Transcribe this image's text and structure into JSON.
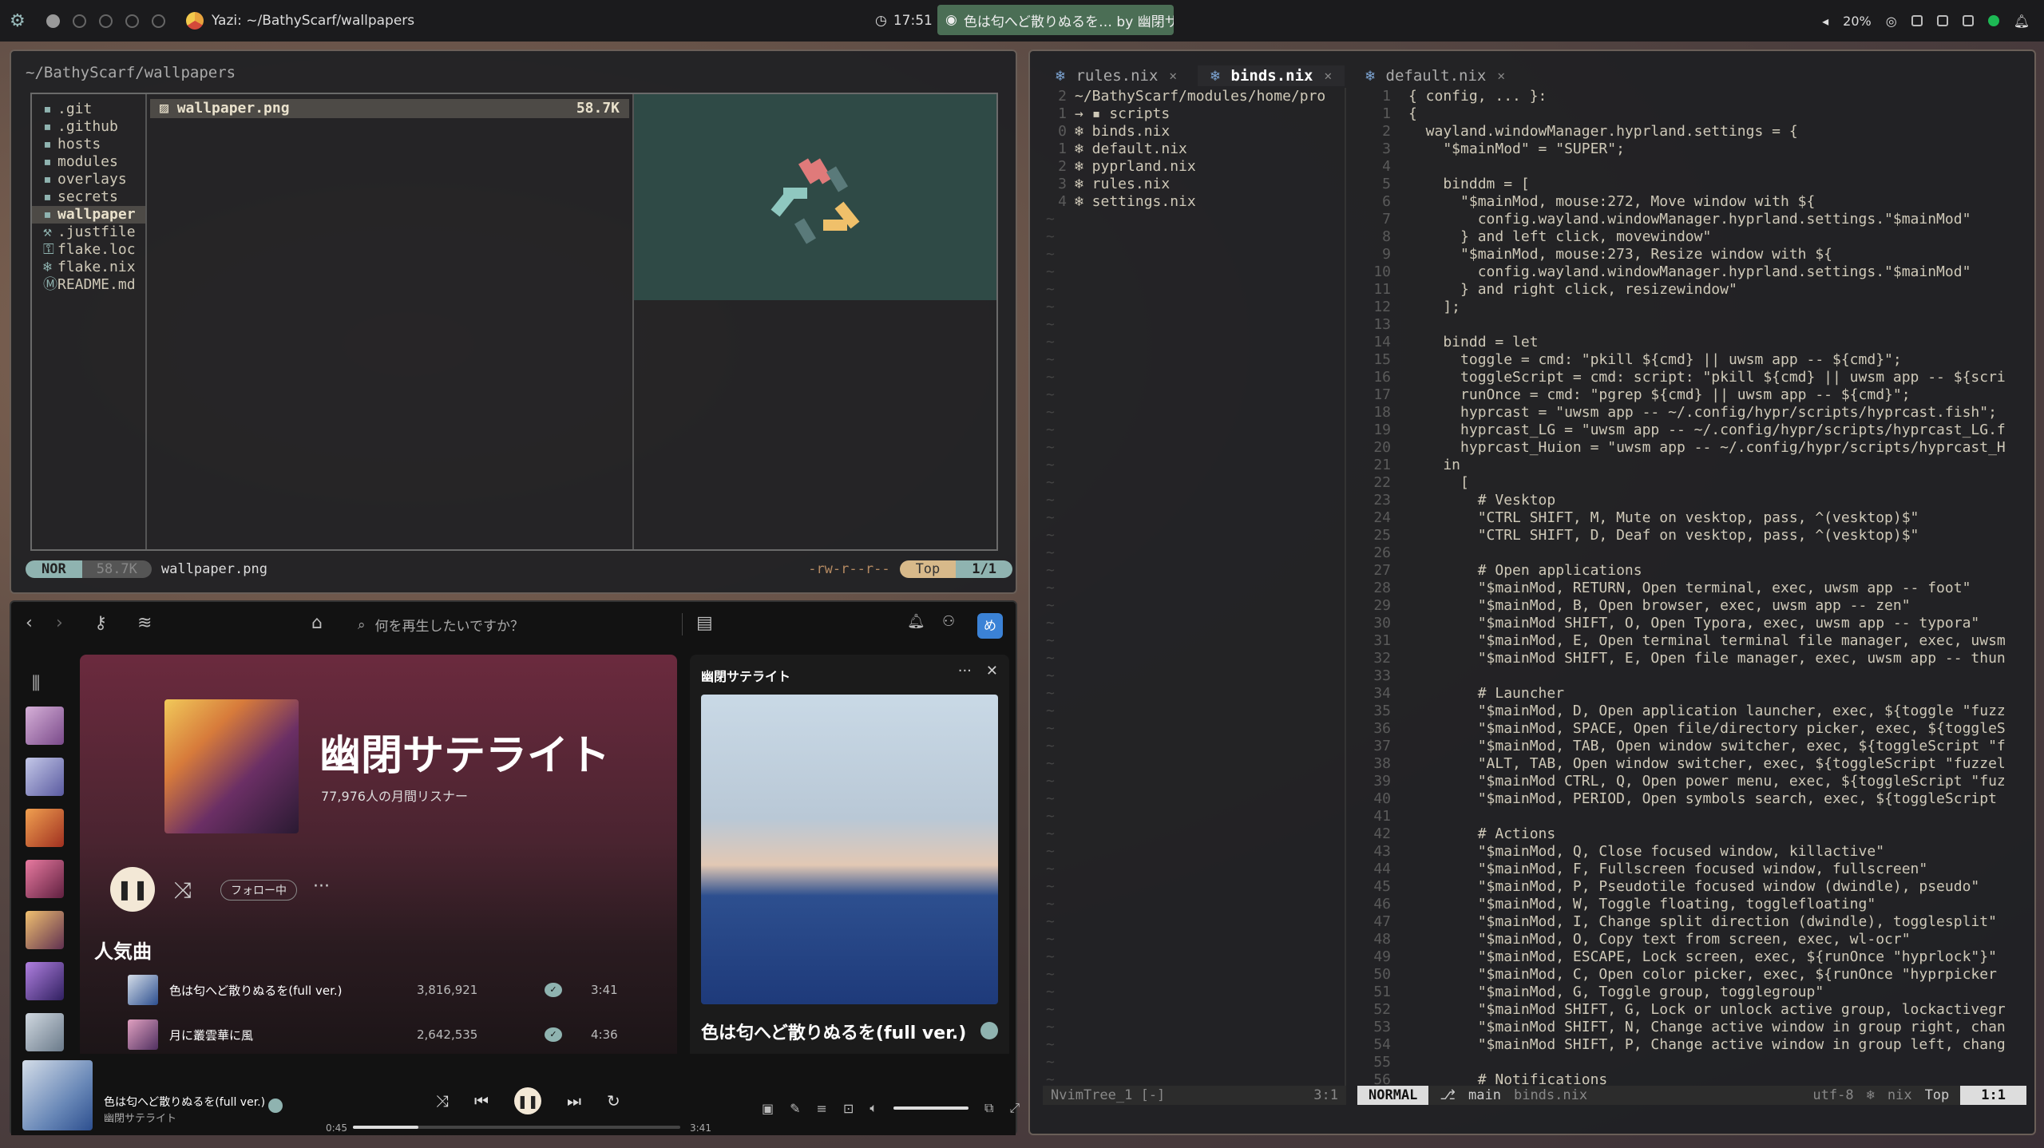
{
  "topbar": {
    "window_title": "Yazi: ~/BathyScarf/wallpapers",
    "clock": "17:51",
    "media": "色は匂へど散りぬるを… by 幽閉サテ…",
    "battery": "20%"
  },
  "yazi": {
    "path": "~/BathyScarf/wallpapers",
    "parent_items": [
      {
        "icon": "folder-icon",
        "glyph": "▪",
        "name": ".git"
      },
      {
        "icon": "folder-icon",
        "glyph": "▪",
        "name": ".github"
      },
      {
        "icon": "folder-icon",
        "glyph": "▪",
        "name": "hosts"
      },
      {
        "icon": "folder-icon",
        "glyph": "▪",
        "name": "modules"
      },
      {
        "icon": "folder-icon",
        "glyph": "▪",
        "name": "overlays"
      },
      {
        "icon": "folder-icon",
        "glyph": "▪",
        "name": "secrets"
      },
      {
        "icon": "folder-icon",
        "glyph": "▪",
        "name": "wallpaper",
        "selected": true
      },
      {
        "icon": "wrench-icon",
        "glyph": "⚒",
        "name": ".justfile"
      },
      {
        "icon": "lock-icon",
        "glyph": "⚿",
        "name": "flake.loc"
      },
      {
        "icon": "nix-icon",
        "glyph": "❄",
        "name": "flake.nix"
      },
      {
        "icon": "markdown-icon",
        "glyph": "Ⓜ",
        "name": "README.md"
      }
    ],
    "files": [
      {
        "name": "wallpaper.png",
        "size": "58.7K"
      }
    ],
    "status": {
      "mode": "NOR",
      "size": "58.7K",
      "filename": "wallpaper.png",
      "permissions": "-rw-r--r--",
      "scroll": "Top",
      "position": "1/1"
    }
  },
  "spotify": {
    "search_placeholder": "何を再生したいですか？",
    "avatar_letter": "め",
    "artist": {
      "name": "幽閉サテライト",
      "listeners": "77,976人の月間リスナー",
      "follow": "フォロー中"
    },
    "popular_heading": "人気曲",
    "tracks": [
      {
        "title": "色は匂へど散りぬるを(full ver.)",
        "plays": "3,816,921",
        "duration": "3:41"
      },
      {
        "title": "月に叢雲華に風",
        "plays": "2,642,535",
        "duration": "4:36"
      }
    ],
    "now_playing_panel": {
      "title": "幽閉サテライト",
      "song": "色は匂へど散りぬるを(full ver.)"
    },
    "player": {
      "song": "色は匂へど散りぬるを(full ver.)",
      "artist": "幽閉サテライト",
      "elapsed": "0:45",
      "total": "3:41",
      "progress": 0.2
    },
    "colors": {
      "accent": "#8fb3b0",
      "banner": "#6b2a3e"
    }
  },
  "nvim": {
    "tabs": [
      {
        "label": "rules.nix",
        "selected": false
      },
      {
        "label": "binds.nix",
        "selected": true
      },
      {
        "label": "default.nix",
        "selected": false
      }
    ],
    "tree_rows": [
      {
        "n": "2",
        "text": "~/BathyScarf/modules/home/pro"
      },
      {
        "n": "1",
        "text": " → ▪ scripts"
      },
      {
        "n": "0",
        "text": "  ❄ binds.nix"
      },
      {
        "n": "1",
        "text": "  ❄ default.nix"
      },
      {
        "n": "2",
        "text": "  ❄ pyprland.nix"
      },
      {
        "n": "3",
        "text": "  ❄ rules.nix"
      },
      {
        "n": "4",
        "text": "  ❄ settings.nix"
      }
    ],
    "code_lines": [
      {
        "n": "1",
        "text": "{ config, ... }:"
      },
      {
        "n": "1",
        "text": "{"
      },
      {
        "n": "2",
        "text": "  wayland.windowManager.hyprland.settings = {"
      },
      {
        "n": "3",
        "text": "    \"$mainMod\" = \"SUPER\";"
      },
      {
        "n": "4",
        "text": ""
      },
      {
        "n": "5",
        "text": "    binddm = ["
      },
      {
        "n": "6",
        "text": "      \"$mainMod, mouse:272, Move window with ${"
      },
      {
        "n": "7",
        "text": "        config.wayland.windowManager.hyprland.settings.\"$mainMod\""
      },
      {
        "n": "8",
        "text": "      } and left click, movewindow\""
      },
      {
        "n": "9",
        "text": "      \"$mainMod, mouse:273, Resize window with ${"
      },
      {
        "n": "10",
        "text": "        config.wayland.windowManager.hyprland.settings.\"$mainMod\""
      },
      {
        "n": "11",
        "text": "      } and right click, resizewindow\""
      },
      {
        "n": "12",
        "text": "    ];"
      },
      {
        "n": "13",
        "text": ""
      },
      {
        "n": "14",
        "text": "    bindd = let"
      },
      {
        "n": "15",
        "text": "      toggle = cmd: \"pkill ${cmd} || uwsm app -- ${cmd}\";"
      },
      {
        "n": "16",
        "text": "      toggleScript = cmd: script: \"pkill ${cmd} || uwsm app -- ${scri"
      },
      {
        "n": "17",
        "text": "      runOnce = cmd: \"pgrep ${cmd} || uwsm app -- ${cmd}\";"
      },
      {
        "n": "18",
        "text": "      hyprcast = \"uwsm app -- ~/.config/hypr/scripts/hyprcast.fish\";"
      },
      {
        "n": "19",
        "text": "      hyprcast_LG = \"uwsm app -- ~/.config/hypr/scripts/hyprcast_LG.f"
      },
      {
        "n": "20",
        "text": "      hyprcast_Huion = \"uwsm app -- ~/.config/hypr/scripts/hyprcast_H"
      },
      {
        "n": "21",
        "text": "    in"
      },
      {
        "n": "22",
        "text": "      ["
      },
      {
        "n": "23",
        "text": "        # Vesktop"
      },
      {
        "n": "24",
        "text": "        \"CTRL SHIFT, M, Mute on vesktop, pass, ^(vesktop)$\""
      },
      {
        "n": "25",
        "text": "        \"CTRL SHIFT, D, Deaf on vesktop, pass, ^(vesktop)$\""
      },
      {
        "n": "26",
        "text": ""
      },
      {
        "n": "27",
        "text": "        # Open applications"
      },
      {
        "n": "28",
        "text": "        \"$mainMod, RETURN, Open terminal, exec, uwsm app -- foot\""
      },
      {
        "n": "29",
        "text": "        \"$mainMod, B, Open browser, exec, uwsm app -- zen\""
      },
      {
        "n": "30",
        "text": "        \"$mainMod SHIFT, O, Open Typora, exec, uwsm app -- typora\""
      },
      {
        "n": "31",
        "text": "        \"$mainMod, E, Open terminal terminal file manager, exec, uwsm"
      },
      {
        "n": "32",
        "text": "        \"$mainMod SHIFT, E, Open file manager, exec, uwsm app -- thun"
      },
      {
        "n": "33",
        "text": ""
      },
      {
        "n": "34",
        "text": "        # Launcher"
      },
      {
        "n": "35",
        "text": "        \"$mainMod, D, Open application launcher, exec, ${toggle \"fuzz"
      },
      {
        "n": "36",
        "text": "        \"$mainMod, SPACE, Open file/directory picker, exec, ${toggleS"
      },
      {
        "n": "37",
        "text": "        \"$mainMod, TAB, Open window switcher, exec, ${toggleScript \"f"
      },
      {
        "n": "38",
        "text": "        \"ALT, TAB, Open window switcher, exec, ${toggleScript \"fuzzel"
      },
      {
        "n": "39",
        "text": "        \"$mainMod CTRL, Q, Open power menu, exec, ${toggleScript \"fuz"
      },
      {
        "n": "40",
        "text": "        \"$mainMod, PERIOD, Open symbols search, exec, ${toggleScript "
      },
      {
        "n": "41",
        "text": ""
      },
      {
        "n": "42",
        "text": "        # Actions"
      },
      {
        "n": "43",
        "text": "        \"$mainMod, Q, Close focused window, killactive\""
      },
      {
        "n": "44",
        "text": "        \"$mainMod, F, Fullscreen focused window, fullscreen\""
      },
      {
        "n": "45",
        "text": "        \"$mainMod, P, Pseudotile focused window (dwindle), pseudo\""
      },
      {
        "n": "46",
        "text": "        \"$mainMod, W, Toggle floating, togglefloating\""
      },
      {
        "n": "47",
        "text": "        \"$mainMod, I, Change split direction (dwindle), togglesplit\""
      },
      {
        "n": "48",
        "text": "        \"$mainMod, O, Copy text from screen, exec, wl-ocr\""
      },
      {
        "n": "49",
        "text": "        \"$mainMod, ESCAPE, Lock screen, exec, ${runOnce \"hyprlock\"}\""
      },
      {
        "n": "50",
        "text": "        \"$mainMod, C, Open color picker, exec, ${runOnce \"hyprpicker"
      },
      {
        "n": "51",
        "text": "        \"$mainMod, G, Toggle group, togglegroup\""
      },
      {
        "n": "52",
        "text": "        \"$mainMod SHIFT, G, Lock or unlock active group, lockactivegr"
      },
      {
        "n": "53",
        "text": "        \"$mainMod SHIFT, N, Change active window in group right, chan"
      },
      {
        "n": "54",
        "text": "        \"$mainMod SHIFT, P, Change active window in group left, chang"
      },
      {
        "n": "55",
        "text": ""
      },
      {
        "n": "56",
        "text": "        # Notifications"
      }
    ],
    "status": {
      "tree_name": "NvimTree_1 [-]",
      "tree_pos": "3:1",
      "mode": "NORMAL",
      "branch": "main",
      "file": "binds.nix",
      "encoding": "utf-8",
      "filetype": "nix",
      "scroll": "Top",
      "position": "1:1"
    }
  }
}
